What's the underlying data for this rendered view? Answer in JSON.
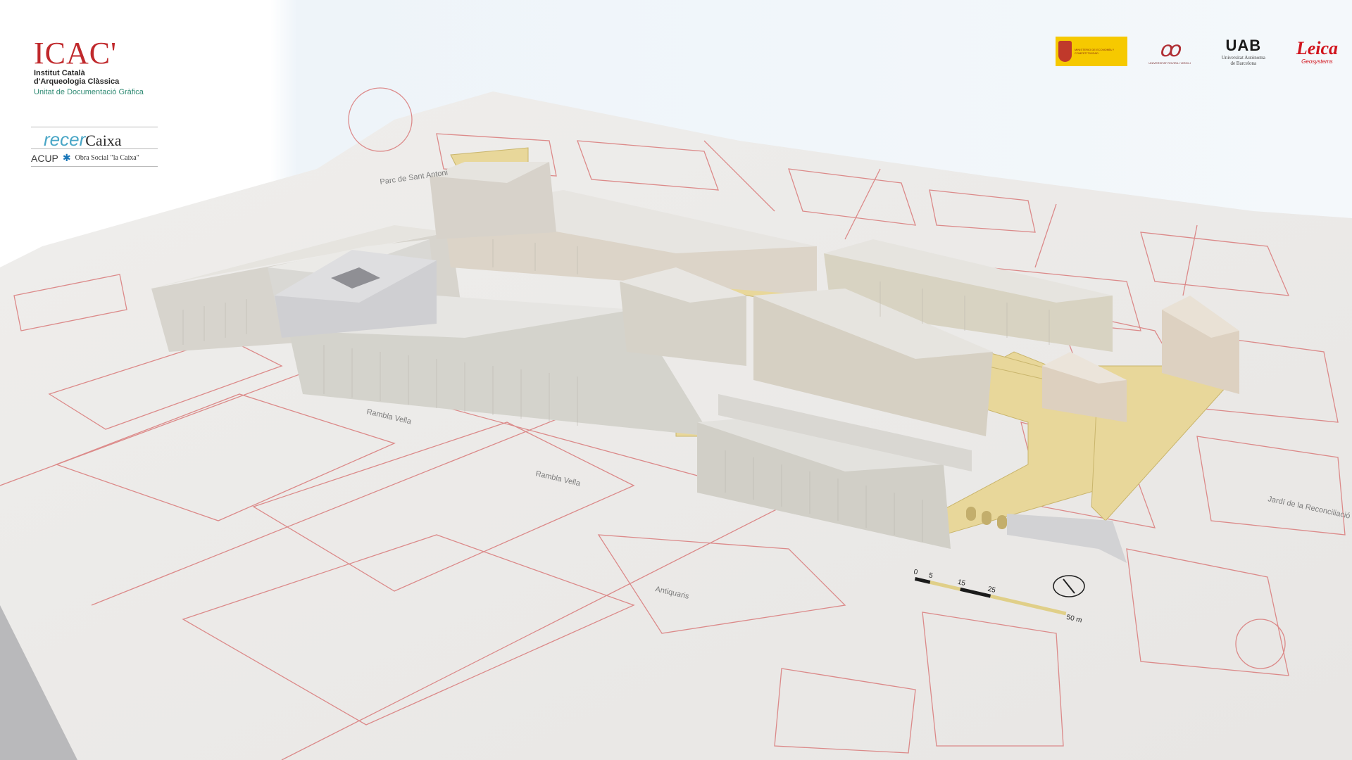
{
  "logos": {
    "icac": {
      "mark": "ICAC'",
      "name_line1": "Institut Català",
      "name_line2": "d'Arqueologia Clàssica",
      "unit": "Unitat de Documentació Gràfica"
    },
    "recercaixa": {
      "brand_prefix": "recer",
      "brand_suffix": "Caixa",
      "acup": "ACUP",
      "obra_social": "Obra Social \"la Caixa\""
    },
    "sponsors": {
      "ministry": "MINISTERIO DE ECONOMÍA Y COMPETITIVIDAD",
      "urv": "UNIVERSITAT ROVIRA I VIRGILI",
      "uab": "UAB",
      "uab_sub_1": "Universitat Autònoma",
      "uab_sub_2": "de Barcelona",
      "leica": "Leica",
      "leica_sub": "Geosystems"
    }
  },
  "map": {
    "street_labels": [
      "Rambla Vella",
      "Rambla Vella",
      "Parc de Sant Antoni",
      "Jardí de la Reconciliació",
      "Antiquaris"
    ],
    "scale_bar": {
      "ticks": [
        "0",
        "5",
        "15",
        "25",
        "50 m"
      ]
    },
    "north_arrow": "north-arrow"
  },
  "colors": {
    "terrain": "#ecebea",
    "plan_lines": "#d65a5a",
    "building": "#d8d6d0",
    "building_roof": "#e5e4e1",
    "excavation": "#e8d79a",
    "brand_red": "#c0292c"
  }
}
